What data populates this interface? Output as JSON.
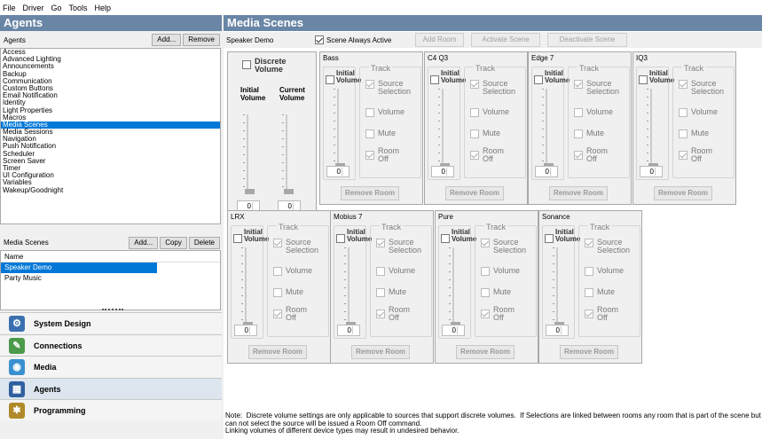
{
  "menu": [
    "File",
    "Driver",
    "Go",
    "Tools",
    "Help"
  ],
  "left": {
    "header": "Agents",
    "agents_label": "Agents",
    "add_label": "Add...",
    "remove_label": "Remove",
    "agents": [
      "Access",
      "Advanced Lighting",
      "Announcements",
      "Backup",
      "Communication",
      "Custom Buttons",
      "Email Notification",
      "Identity",
      "Light Properties",
      "Macros",
      "Media Scenes",
      "Media Sessions",
      "Navigation",
      "Push Notification",
      "Scheduler",
      "Screen Saver",
      "Timer",
      "UI Configuration",
      "Variables",
      "Wakeup/Goodnight"
    ],
    "selected_agent": "Media Scenes",
    "scenes_label": "Media Scenes",
    "scenes_add": "Add...",
    "scenes_copy": "Copy",
    "scenes_delete": "Delete",
    "scenes_col": "Name",
    "scenes": [
      "Speaker Demo",
      "Party Music"
    ],
    "selected_scene": "Speaker Demo",
    "nav": [
      {
        "label": "System Design",
        "icon": "system-design-icon",
        "color": "#3a6fb0"
      },
      {
        "label": "Connections",
        "icon": "connections-icon",
        "color": "#4a9a4a"
      },
      {
        "label": "Media",
        "icon": "media-icon",
        "color": "#3a8fd0"
      },
      {
        "label": "Agents",
        "icon": "agents-icon",
        "color": "#2f5fa0"
      },
      {
        "label": "Programming",
        "icon": "programming-icon",
        "color": "#b08a2a"
      }
    ]
  },
  "right": {
    "header": "Media Scenes",
    "scene_name": "Speaker Demo",
    "always_active": "Scene Always Active",
    "add_room": "Add Room",
    "activate": "Activate Scene",
    "deactivate": "Deactivate Scene",
    "discrete": {
      "label": "Discrete Volume",
      "initial": "Initial Volume",
      "current": "Current Volume",
      "initial_value": "0",
      "current_value": "0"
    },
    "room_labels": {
      "initial": "Initial Volume",
      "track": "Track",
      "source": "Source Selection",
      "volume": "Volume",
      "mute": "Mute",
      "room_off": "Room Off",
      "remove": "Remove Room"
    },
    "rooms": [
      {
        "name": "Bass",
        "value": "0"
      },
      {
        "name": "C4 Q3",
        "value": "0"
      },
      {
        "name": "Edge 7",
        "value": "0"
      },
      {
        "name": "IQ3",
        "value": "0"
      },
      {
        "name": "LRX",
        "value": "0"
      },
      {
        "name": "Mobius 7",
        "value": "0"
      },
      {
        "name": "Pure",
        "value": "0"
      },
      {
        "name": "Sonance",
        "value": "0"
      }
    ],
    "note": "Note:  Discrete volume settings are only applicable to sources that support discrete volumes.  If Selections are linked between rooms any room that is part of the scene but can not select the source will be issued a Room Off command.\nLinking volumes of different device types may result in undesired behavior."
  }
}
